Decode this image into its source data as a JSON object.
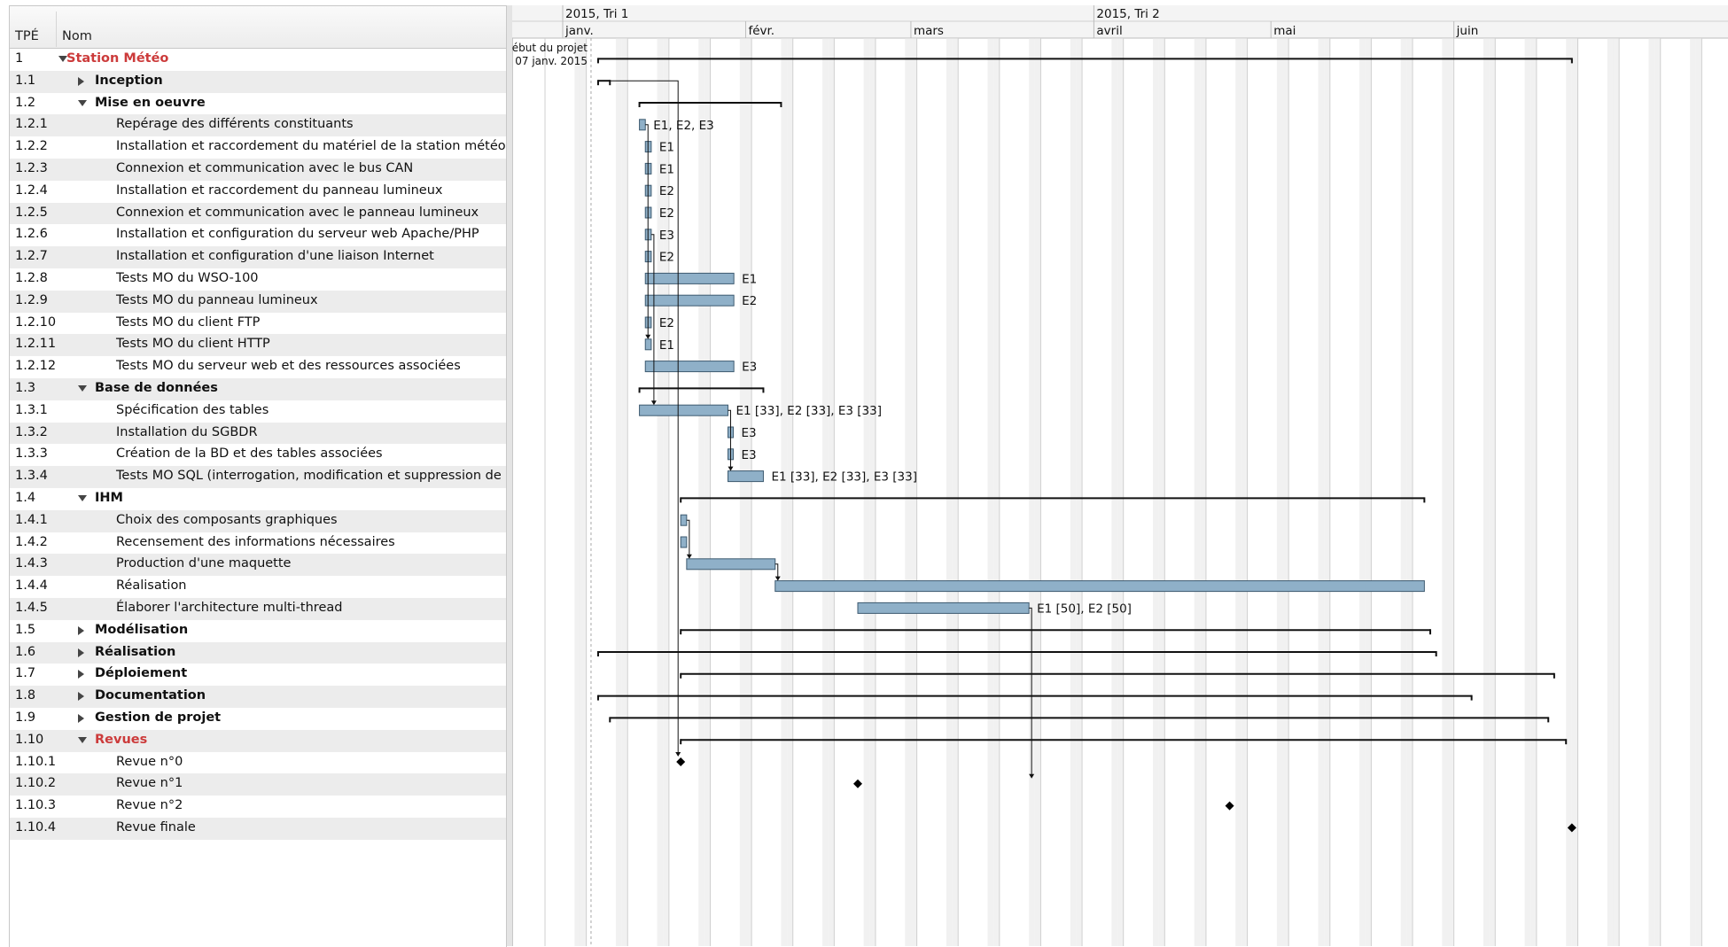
{
  "columns": {
    "id": "TPÉ",
    "name": "Nom"
  },
  "timeline": {
    "quarters": [
      {
        "label": "2015, Tri 1",
        "start": "2015-01-01"
      },
      {
        "label": "2015, Tri 2",
        "start": "2015-04-01"
      }
    ],
    "months": [
      {
        "label": "janv.",
        "start": "2015-01-01"
      },
      {
        "label": "févr.",
        "start": "2015-02-01"
      },
      {
        "label": "mars",
        "start": "2015-03-01"
      },
      {
        "label": "avril",
        "start": "2015-04-01"
      },
      {
        "label": "mai",
        "start": "2015-05-01"
      },
      {
        "label": "juin",
        "start": "2015-06-01"
      }
    ],
    "project_start_label": "Début du projet",
    "project_start_date": "07 janv. 2015"
  },
  "tasks": [
    {
      "id": "1",
      "name": "Station Météo",
      "level": 0,
      "group": true,
      "expanded": true,
      "red": true,
      "kind": "summary",
      "start": "2015-01-07",
      "end": "2015-06-21"
    },
    {
      "id": "1.1",
      "name": "Inception",
      "level": 1,
      "group": true,
      "expanded": false,
      "kind": "summary",
      "start": "2015-01-07",
      "end": "2015-01-09"
    },
    {
      "id": "1.2",
      "name": "Mise en oeuvre",
      "level": 1,
      "group": true,
      "expanded": true,
      "kind": "summary",
      "start": "2015-01-14",
      "end": "2015-02-07"
    },
    {
      "id": "1.2.1",
      "name": "Repérage des différents constituants",
      "level": 2,
      "kind": "task",
      "start": "2015-01-14",
      "end": "2015-01-15",
      "resources": "E1, E2, E3"
    },
    {
      "id": "1.2.2",
      "name": "Installation et raccordement du matériel de la station météo",
      "level": 2,
      "kind": "task",
      "start": "2015-01-15",
      "end": "2015-01-16",
      "resources": "E1"
    },
    {
      "id": "1.2.3",
      "name": "Connexion et communication avec le bus CAN",
      "level": 2,
      "kind": "task",
      "start": "2015-01-15",
      "end": "2015-01-16",
      "resources": "E1"
    },
    {
      "id": "1.2.4",
      "name": "Installation et raccordement du panneau lumineux",
      "level": 2,
      "kind": "task",
      "start": "2015-01-15",
      "end": "2015-01-16",
      "resources": "E2"
    },
    {
      "id": "1.2.5",
      "name": "Connexion et communication avec le panneau lumineux",
      "level": 2,
      "kind": "task",
      "start": "2015-01-15",
      "end": "2015-01-16",
      "resources": "E2"
    },
    {
      "id": "1.2.6",
      "name": "Installation et configuration du serveur web Apache/PHP",
      "level": 2,
      "kind": "task",
      "start": "2015-01-15",
      "end": "2015-01-16",
      "resources": "E3"
    },
    {
      "id": "1.2.7",
      "name": "Installation et configuration d'une liaison Internet",
      "level": 2,
      "kind": "task",
      "start": "2015-01-15",
      "end": "2015-01-16",
      "resources": "E2"
    },
    {
      "id": "1.2.8",
      "name": "Tests MO du WSO-100",
      "level": 2,
      "kind": "task",
      "start": "2015-01-15",
      "end": "2015-01-30",
      "resources": "E1"
    },
    {
      "id": "1.2.9",
      "name": "Tests MO du panneau lumineux",
      "level": 2,
      "kind": "task",
      "start": "2015-01-15",
      "end": "2015-01-30",
      "resources": "E2"
    },
    {
      "id": "1.2.10",
      "name": "Tests MO du client FTP",
      "level": 2,
      "kind": "task",
      "start": "2015-01-15",
      "end": "2015-01-16",
      "resources": "E2"
    },
    {
      "id": "1.2.11",
      "name": "Tests MO du client HTTP",
      "level": 2,
      "kind": "task",
      "start": "2015-01-15",
      "end": "2015-01-16",
      "resources": "E1"
    },
    {
      "id": "1.2.12",
      "name": "Tests MO du serveur web et des ressources associées",
      "level": 2,
      "kind": "task",
      "start": "2015-01-15",
      "end": "2015-01-30",
      "resources": "E3"
    },
    {
      "id": "1.3",
      "name": "Base de données",
      "level": 1,
      "group": true,
      "expanded": true,
      "kind": "summary",
      "start": "2015-01-14",
      "end": "2015-02-04"
    },
    {
      "id": "1.3.1",
      "name": "Spécification des tables",
      "level": 2,
      "kind": "task",
      "start": "2015-01-14",
      "end": "2015-01-29",
      "resources": "E1 [33], E2 [33], E3 [33]"
    },
    {
      "id": "1.3.2",
      "name": "Installation du SGBDR",
      "level": 2,
      "kind": "task",
      "start": "2015-01-29",
      "end": "2015-01-29",
      "resources": "E3"
    },
    {
      "id": "1.3.3",
      "name": "Création de la BD et des tables associées",
      "level": 2,
      "kind": "task",
      "start": "2015-01-29",
      "end": "2015-01-29",
      "resources": "E3"
    },
    {
      "id": "1.3.4",
      "name": "Tests MO SQL (interrogation, modification et suppression de",
      "level": 2,
      "kind": "task",
      "start": "2015-01-29",
      "end": "2015-02-04",
      "resources": "E1 [33], E2 [33], E3 [33]"
    },
    {
      "id": "1.4",
      "name": "IHM",
      "level": 1,
      "group": true,
      "expanded": true,
      "kind": "summary",
      "start": "2015-01-21",
      "end": "2015-05-27"
    },
    {
      "id": "1.4.1",
      "name": "Choix des composants graphiques",
      "level": 2,
      "kind": "task",
      "start": "2015-01-21",
      "end": "2015-01-22"
    },
    {
      "id": "1.4.2",
      "name": "Recensement des informations nécessaires",
      "level": 2,
      "kind": "task",
      "start": "2015-01-21",
      "end": "2015-01-22"
    },
    {
      "id": "1.4.3",
      "name": "Production d'une maquette",
      "level": 2,
      "kind": "task",
      "start": "2015-01-22",
      "end": "2015-02-06"
    },
    {
      "id": "1.4.4",
      "name": "Réalisation",
      "level": 2,
      "kind": "task",
      "start": "2015-02-06",
      "end": "2015-05-27"
    },
    {
      "id": "1.4.5",
      "name": "Élaborer l'architecture multi-thread",
      "level": 2,
      "kind": "task",
      "start": "2015-02-20",
      "end": "2015-03-21",
      "resources": "E1 [50], E2 [50]"
    },
    {
      "id": "1.5",
      "name": "Modélisation",
      "level": 1,
      "group": true,
      "expanded": false,
      "kind": "summary",
      "start": "2015-01-21",
      "end": "2015-05-28"
    },
    {
      "id": "1.6",
      "name": "Réalisation",
      "level": 1,
      "group": true,
      "expanded": false,
      "kind": "summary",
      "start": "2015-01-07",
      "end": "2015-05-29"
    },
    {
      "id": "1.7",
      "name": "Déploiement",
      "level": 1,
      "group": true,
      "expanded": false,
      "kind": "summary",
      "start": "2015-01-21",
      "end": "2015-06-18"
    },
    {
      "id": "1.8",
      "name": "Documentation",
      "level": 1,
      "group": true,
      "expanded": false,
      "kind": "summary",
      "start": "2015-01-07",
      "end": "2015-06-04"
    },
    {
      "id": "1.9",
      "name": "Gestion de projet",
      "level": 1,
      "group": true,
      "expanded": false,
      "kind": "summary",
      "start": "2015-01-09",
      "end": "2015-06-17"
    },
    {
      "id": "1.10",
      "name": "Revues",
      "level": 1,
      "group": true,
      "expanded": true,
      "red": true,
      "kind": "summary",
      "start": "2015-01-21",
      "end": "2015-06-20"
    },
    {
      "id": "1.10.1",
      "name": "Revue n°0",
      "level": 2,
      "kind": "milestone",
      "start": "2015-01-21"
    },
    {
      "id": "1.10.2",
      "name": "Revue n°1",
      "level": 2,
      "kind": "milestone",
      "start": "2015-02-20"
    },
    {
      "id": "1.10.3",
      "name": "Revue n°2",
      "level": 2,
      "kind": "milestone",
      "start": "2015-04-24"
    },
    {
      "id": "1.10.4",
      "name": "Revue finale",
      "level": 2,
      "kind": "milestone",
      "start": "2015-06-21"
    }
  ],
  "dependencies": [
    [
      "1.1",
      "1.10.1"
    ],
    [
      "1.2.1",
      "1.2.11"
    ],
    [
      "1.2.6",
      "1.3.1"
    ],
    [
      "1.3.1",
      "1.3.4"
    ],
    [
      "1.4.1",
      "1.4.3"
    ],
    [
      "1.4.3",
      "1.4.4"
    ],
    [
      "1.4.5",
      "1.10.2"
    ]
  ],
  "colors": {
    "bar": "#8fb0c8",
    "bar_border": "#3d5a70",
    "summary": "#111111",
    "red_text": "#cc3b3b",
    "alt_row": "#ececec",
    "weekend": "#e6e6e6"
  }
}
